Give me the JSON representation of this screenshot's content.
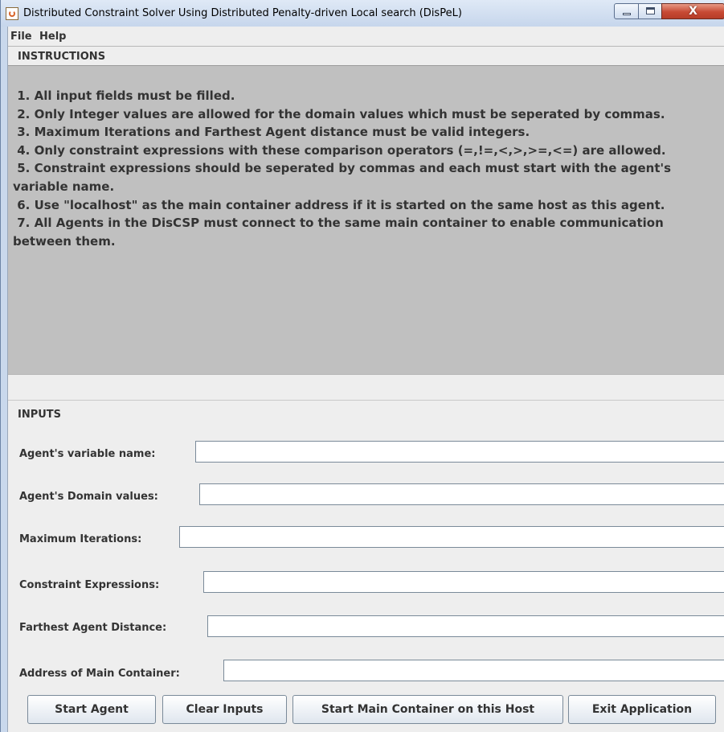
{
  "window": {
    "title": "Distributed Constraint Solver Using Distributed Penalty-driven Local search (DisPeL)",
    "close_glyph": "X"
  },
  "menu": {
    "items": [
      {
        "label": "File"
      },
      {
        "label": "Help"
      }
    ]
  },
  "instructions": {
    "title": "INSTRUCTIONS",
    "text": " 1. All input fields must be filled.\n 2. Only Integer values are allowed for the domain values which must be seperated by commas.\n 3. Maximum Iterations and Farthest Agent distance must be valid integers.\n 4. Only constraint expressions with these comparison operators (=,!=,<,>,>=,<=) are allowed.\n 5. Constraint expressions should be seperated by commas and each must start with the agent's variable name.\n 6. Use \"localhost\" as the main container address if it is started on the same host as this agent.\n 7. All Agents in the DisCSP must connect to the same main container to enable communication between them."
  },
  "inputs": {
    "title": "INPUTS",
    "fields": [
      {
        "label": "Agent's variable name:",
        "value": ""
      },
      {
        "label": "Agent's Domain values:",
        "value": ""
      },
      {
        "label": "Maximum Iterations:",
        "value": ""
      },
      {
        "label": "Constraint Expressions:",
        "value": ""
      },
      {
        "label": "Farthest Agent Distance:",
        "value": ""
      },
      {
        "label": "Address of Main Container:",
        "value": ""
      }
    ]
  },
  "buttons": {
    "start_agent": "Start Agent",
    "clear_inputs": "Clear Inputs",
    "start_main_container": "Start Main Container on this Host",
    "exit_application": "Exit Application"
  }
}
